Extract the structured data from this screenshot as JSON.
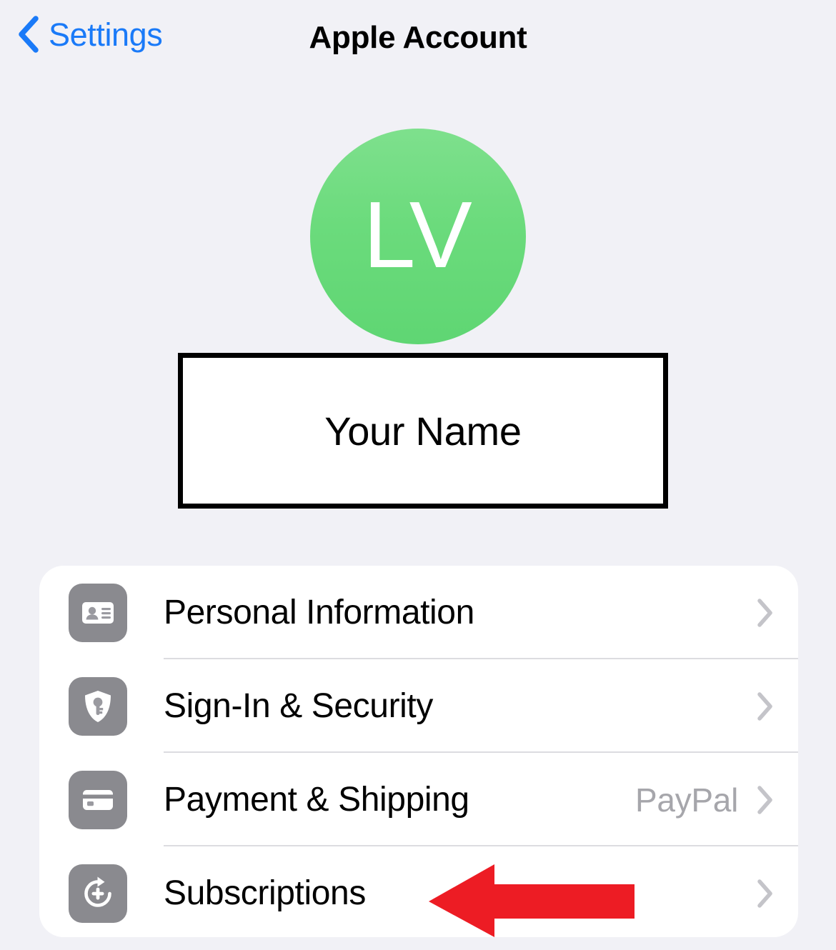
{
  "navbar": {
    "back_label": "Settings",
    "back_icon": "chevron-left-icon",
    "title": "Apple Account"
  },
  "profile": {
    "avatar_initials": "LV",
    "avatar_color": "#6BDB7C",
    "name_label": "Your Name"
  },
  "list": {
    "rows": [
      {
        "label": "Personal Information",
        "value": "",
        "icon": "contact-card-icon",
        "accessory": "chevron-right-icon"
      },
      {
        "label": "Sign-In & Security",
        "value": "",
        "icon": "shield-key-icon",
        "accessory": "chevron-right-icon"
      },
      {
        "label": "Payment & Shipping",
        "value": "PayPal",
        "icon": "credit-card-icon",
        "accessory": "chevron-right-icon"
      },
      {
        "label": "Subscriptions",
        "value": "",
        "icon": "subscription-renew-icon",
        "accessory": "chevron-right-icon"
      }
    ]
  },
  "annotation": {
    "arrow": "red-left-arrow",
    "color": "#ED1C24",
    "points_to": "Subscriptions"
  },
  "colors": {
    "background": "#F1F1F6",
    "card": "#FFFFFF",
    "accent_blue": "#1A7AF8",
    "icon_gray": "#8A8A8F",
    "chevron_gray": "#C4C4C9",
    "separator": "#DCDCE0",
    "annotation_red": "#ED1C24"
  }
}
